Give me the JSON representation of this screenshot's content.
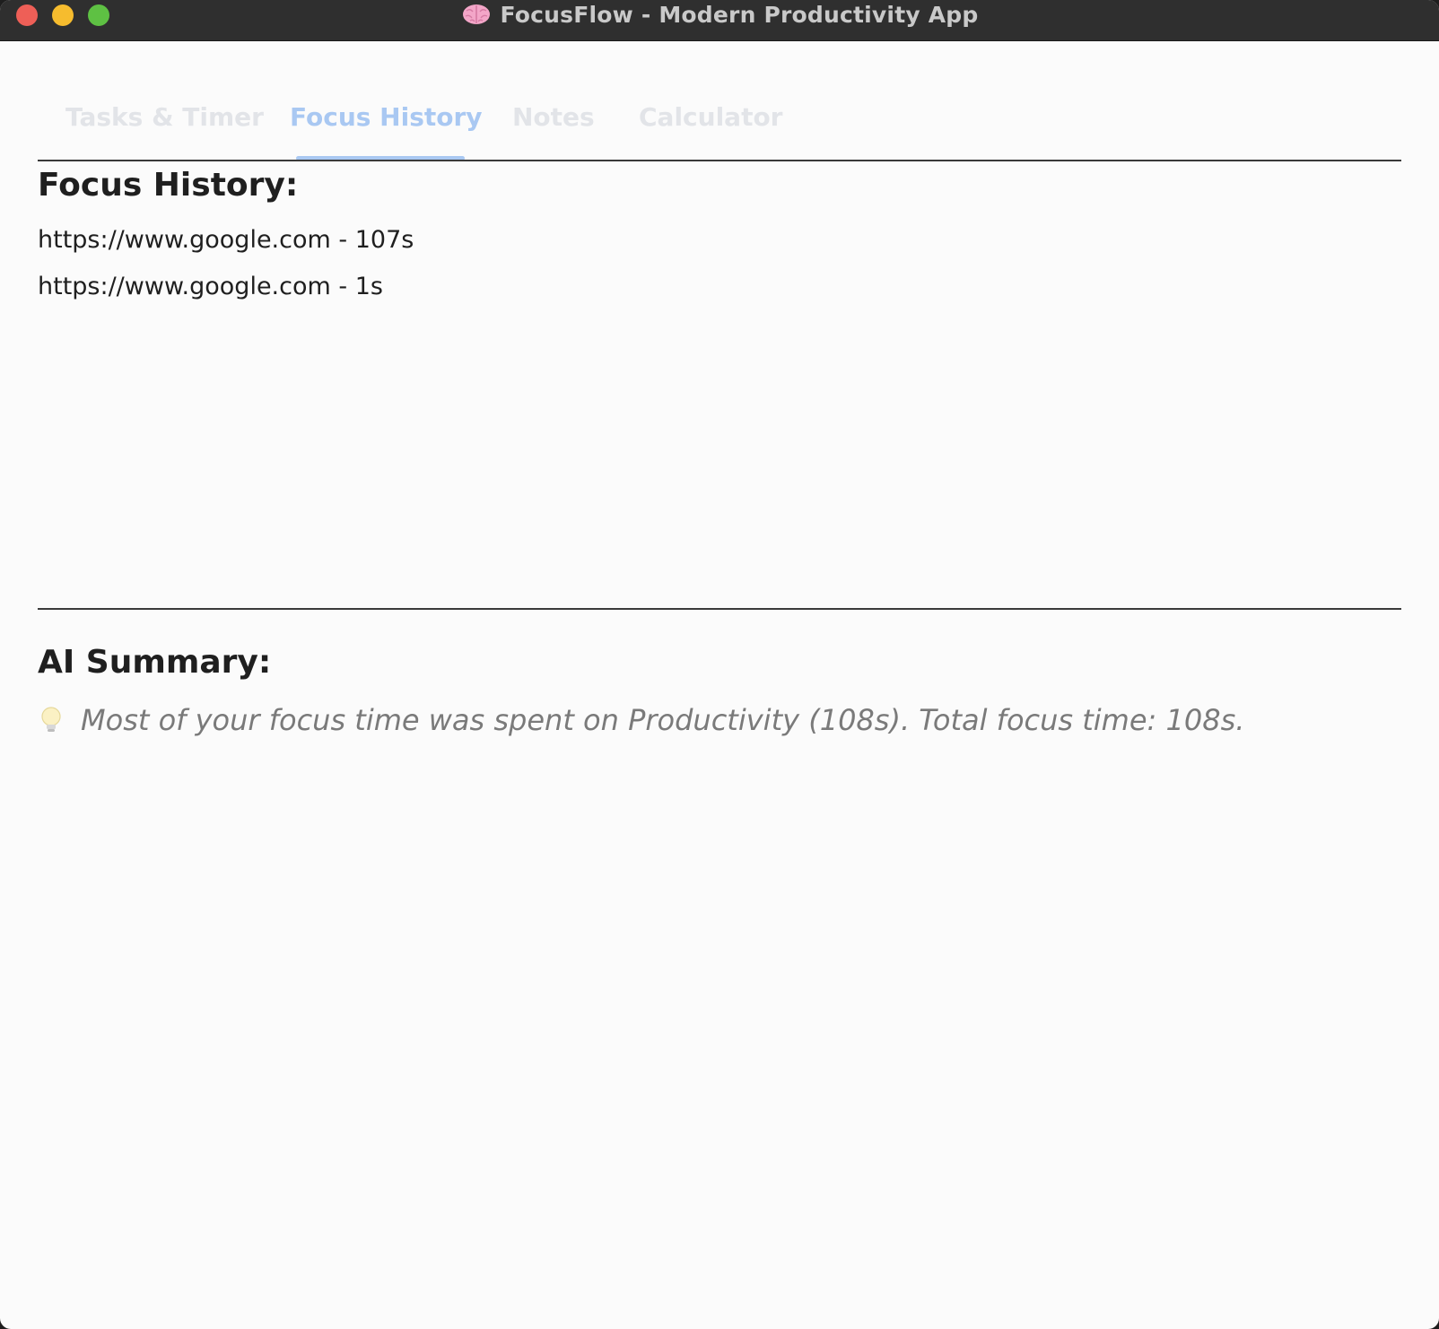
{
  "window": {
    "title": "FocusFlow - Modern Productivity App",
    "title_icon": "brain-icon"
  },
  "tabs": [
    {
      "label": "Tasks & Timer",
      "active": false
    },
    {
      "label": "Focus History",
      "active": true
    },
    {
      "label": "Notes",
      "active": false
    },
    {
      "label": "Calculator",
      "active": false
    }
  ],
  "history": {
    "heading": "Focus History:",
    "items": [
      "https://www.google.com - 107s",
      "https://www.google.com - 1s"
    ]
  },
  "summary": {
    "heading": "AI Summary:",
    "icon": "lightbulb-icon",
    "text": "Most of your focus time was spent on Productivity (108s). Total focus time: 108s."
  },
  "colors": {
    "active_tab": "#a9c8f2",
    "inactive_tab": "#e2e4e8",
    "titlebar": "#2f2f2f",
    "background": "#fbfbfb"
  }
}
